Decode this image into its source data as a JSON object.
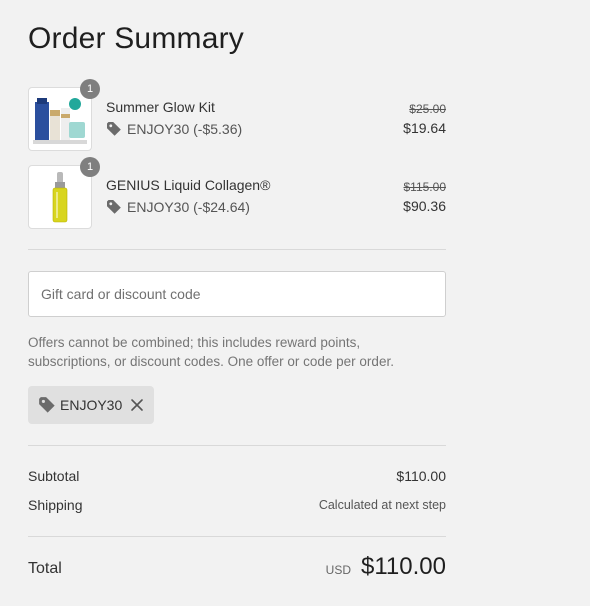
{
  "summary": {
    "title": "Order Summary"
  },
  "items": [
    {
      "name": "Summer Glow Kit",
      "quantity": "1",
      "discount": "ENJOY30 (-$5.36)",
      "original_price": "$25.00",
      "price": "$19.64"
    },
    {
      "name": "GENIUS Liquid Collagen®",
      "quantity": "1",
      "discount": "ENJOY30 (-$24.64)",
      "original_price": "$115.00",
      "price": "$90.36"
    }
  ],
  "discount_form": {
    "placeholder": "Gift card or discount code",
    "note": "Offers cannot be combined; this includes reward points, subscriptions, or discount codes. One offer or code per order.",
    "applied_code": "ENJOY30"
  },
  "totals": {
    "subtotal_label": "Subtotal",
    "subtotal_value": "$110.00",
    "shipping_label": "Shipping",
    "shipping_value": "Calculated at next step",
    "total_label": "Total",
    "currency": "USD",
    "total_value": "$110.00"
  },
  "icons": {
    "tag": "tag-icon",
    "remove": "close-icon"
  },
  "colors": {
    "background": "#f2f2f2",
    "badge": "#7f7f7f",
    "chip": "#e0e0e0"
  }
}
